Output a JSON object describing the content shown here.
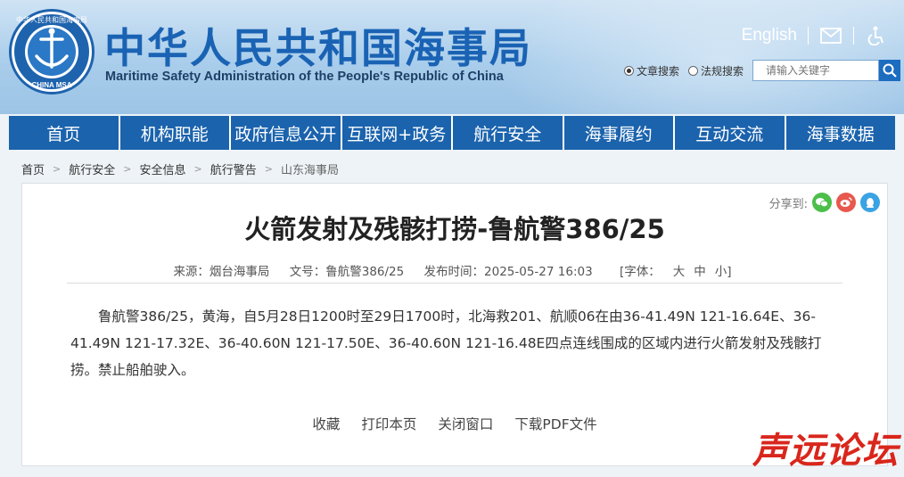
{
  "header": {
    "logo_text_top": "中华人民共和国海事局",
    "logo_text_bottom": "CHINA MSA",
    "title_cn": "中华人民共和国海事局",
    "title_en": "Maritime Safety Administration of the People's Republic of China",
    "lang_link": "English",
    "mail_icon": "mail-icon",
    "accessibility_icon": "accessibility-icon"
  },
  "search": {
    "option_article": "文章搜索",
    "option_regulation": "法规搜索",
    "placeholder": "请输入关键字",
    "search_icon": "search-icon"
  },
  "nav": {
    "items": [
      "首页",
      "机构职能",
      "政府信息公开",
      "互联网+政务",
      "航行安全",
      "海事履约",
      "互动交流",
      "海事数据"
    ]
  },
  "breadcrumb": [
    "首页",
    "航行安全",
    "安全信息",
    "航行警告",
    "山东海事局"
  ],
  "article": {
    "share_label": "分享到:",
    "share_icons": [
      "wechat-icon",
      "weibo-icon",
      "qq-icon"
    ],
    "title": "火箭发射及残骸打捞-鲁航警386/25",
    "source": "来源：烟台海事局",
    "doc_no": "文号：鲁航警386/25",
    "publish_time": "发布时间：2025-05-27 16:03",
    "font_label": "[字体：",
    "font_large": "大",
    "font_medium": "中",
    "font_small": "小]",
    "body": "鲁航警386/25，黄海，自5月28日1200时至29日1700时，北海救201、航顺06在由36-41.49N 121-16.64E、36-41.49N 121-17.32E、36-40.60N 121-17.50E、36-40.60N 121-16.48E四点连线围成的区域内进行火箭发射及残骸打捞。禁止船舶驶入。",
    "actions": [
      "收藏",
      "打印本页",
      "关闭窗口",
      "下载PDF文件"
    ]
  },
  "watermark": "声远论坛",
  "colors": {
    "brand_blue": "#1b63ad",
    "title_blue": "#1a63b4",
    "watermark_red": "#d9261c"
  }
}
